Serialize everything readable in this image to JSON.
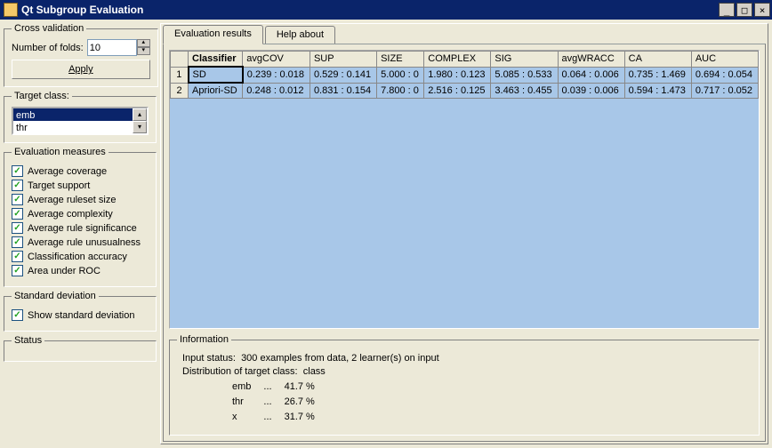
{
  "window": {
    "title": "Qt Subgroup Evaluation"
  },
  "cross_validation": {
    "legend": "Cross validation",
    "folds_label": "Number of folds:",
    "folds_value": "10",
    "apply_label": "Apply"
  },
  "target_class": {
    "legend": "Target class:",
    "items": [
      "emb",
      "thr"
    ],
    "selected_index": 0
  },
  "measures": {
    "legend": "Evaluation measures",
    "items": [
      {
        "label": "Average coverage",
        "checked": true
      },
      {
        "label": "Target support",
        "checked": true
      },
      {
        "label": "Average ruleset size",
        "checked": true
      },
      {
        "label": "Average complexity",
        "checked": true
      },
      {
        "label": "Average rule significance",
        "checked": true
      },
      {
        "label": "Average rule unusualness",
        "checked": true
      },
      {
        "label": "Classification accuracy",
        "checked": true
      },
      {
        "label": "Area under ROC",
        "checked": true
      }
    ]
  },
  "stddev": {
    "legend": "Standard deviation",
    "checkbox_label": "Show standard deviation",
    "checked": true
  },
  "status": {
    "legend": "Status"
  },
  "tabs": {
    "results": "Evaluation results",
    "help": "Help about",
    "active": 0
  },
  "table": {
    "headers": [
      "Classifier",
      "avgCOV",
      "SUP",
      "SIZE",
      "COMPLEX",
      "SIG",
      "avgWRACC",
      "CA",
      "AUC"
    ],
    "rows": [
      {
        "n": "1",
        "cells": [
          "SD",
          "0.239 : 0.018",
          "0.529 : 0.141",
          "5.000 : 0",
          "1.980 : 0.123",
          "5.085 : 0.533",
          "0.064 : 0.006",
          "0.735 : 1.469",
          "0.694 : 0.054"
        ]
      },
      {
        "n": "2",
        "cells": [
          "Apriori-SD",
          "0.248 : 0.012",
          "0.831 : 0.154",
          "7.800 : 0",
          "2.516 : 0.125",
          "3.463 : 0.455",
          "0.039 : 0.006",
          "0.594 : 1.473",
          "0.717 : 0.052"
        ]
      }
    ],
    "selected": {
      "row": 0,
      "col": 0
    }
  },
  "info": {
    "legend": "Information",
    "input_status_label": "Input status:",
    "input_status_value": "300 examples from data, 2 learner(s) on input",
    "dist_label": "Distribution of target class:",
    "dist_target": "class",
    "distribution": [
      {
        "name": "emb",
        "pct": "41.7 %"
      },
      {
        "name": "thr",
        "pct": "26.7 %"
      },
      {
        "name": "x",
        "pct": "31.7 %"
      }
    ]
  }
}
